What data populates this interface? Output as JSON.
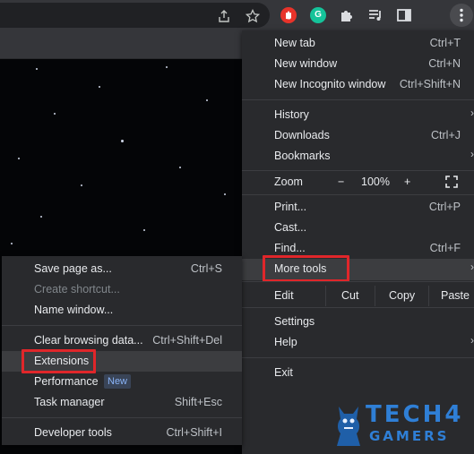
{
  "toolbar": {
    "icons": [
      "share-icon",
      "star-bookmark-icon",
      "adblock-extension-icon",
      "grammarly-extension-icon",
      "extensions-puzzle-icon",
      "reading-list-icon",
      "side-panel-icon",
      "more-menu-icon"
    ],
    "grammarly_glyph": "G"
  },
  "main_menu": {
    "new_tab": {
      "label": "New tab",
      "shortcut": "Ctrl+T"
    },
    "new_window": {
      "label": "New window",
      "shortcut": "Ctrl+N"
    },
    "new_incognito": {
      "label": "New Incognito window",
      "shortcut": "Ctrl+Shift+N"
    },
    "history": {
      "label": "History"
    },
    "downloads": {
      "label": "Downloads",
      "shortcut": "Ctrl+J"
    },
    "bookmarks": {
      "label": "Bookmarks"
    },
    "zoom": {
      "label": "Zoom",
      "minus": "−",
      "level": "100%",
      "plus": "+"
    },
    "print": {
      "label": "Print...",
      "shortcut": "Ctrl+P"
    },
    "cast": {
      "label": "Cast..."
    },
    "find": {
      "label": "Find...",
      "shortcut": "Ctrl+F"
    },
    "more_tools": {
      "label": "More tools"
    },
    "edit": {
      "label": "Edit",
      "cut": "Cut",
      "copy": "Copy",
      "paste": "Paste"
    },
    "settings": {
      "label": "Settings"
    },
    "help": {
      "label": "Help"
    },
    "exit": {
      "label": "Exit"
    },
    "submenu_arrow": "›"
  },
  "sub_menu": {
    "save_page": {
      "label": "Save page as...",
      "shortcut": "Ctrl+S"
    },
    "create_shortcut": {
      "label": "Create shortcut..."
    },
    "name_window": {
      "label": "Name window..."
    },
    "clear_browsing": {
      "label": "Clear browsing data...",
      "shortcut": "Ctrl+Shift+Del"
    },
    "extensions": {
      "label": "Extensions"
    },
    "performance": {
      "label": "Performance",
      "badge": "New"
    },
    "task_manager": {
      "label": "Task manager",
      "shortcut": "Shift+Esc"
    },
    "developer_tools": {
      "label": "Developer tools",
      "shortcut": "Ctrl+Shift+I"
    }
  },
  "watermark": {
    "line1": "TECH4",
    "line2": "GAMERS"
  },
  "colors": {
    "highlight_box": "#e0262a",
    "menu_bg": "#292a2d",
    "logo_blue": "#2f7fd6"
  }
}
